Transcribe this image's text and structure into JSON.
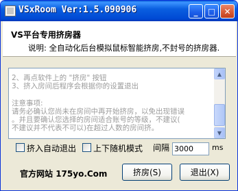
{
  "window": {
    "title": "VSxRoom Ver:1.5.090906",
    "controls": {
      "minimize": "_",
      "maximize": "□",
      "close": "✕"
    }
  },
  "header": {
    "title": "VS平台专用挤房器",
    "description": "说明: 全自动化后台模拟鼠标智能挤房,不封号的挤房器."
  },
  "instructions": {
    "lines": [
      "2、再点软件上的 \"挤房\" 按钮",
      "3、挤入房间后程序会根据你的设置退出",
      "",
      "注意事项:",
      "请务必确认您尚未在房间中再开始挤房，以免出现错误",
      "。并且要确认您选择的房间适合账号的等级，不建议(",
      "不建议并不代表不可以)在超过人数的房间挤。"
    ],
    "scroll_icons": {
      "up": "▲",
      "down": "▼"
    }
  },
  "options": {
    "auto_exit_label": "挤入自动退出",
    "auto_exit_checked": false,
    "random_mode_label": "上下随机模式",
    "random_mode_checked": false,
    "interval_label": "间隔",
    "interval_value": "3000",
    "interval_unit": "ms"
  },
  "footer": {
    "site_label": "官方网站",
    "site_url": "175yo.Com",
    "grab_button": "挤房(S)",
    "exit_button": "退出(X)"
  }
}
